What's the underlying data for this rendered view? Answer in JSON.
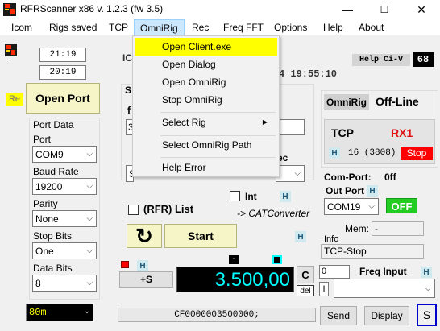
{
  "window": {
    "title": "RFRScanner  x86 v. 1.2.3  (fw 3.5)",
    "minimize": "—",
    "maximize": "☐",
    "close": "✕"
  },
  "menu": {
    "items": [
      "Icom",
      "Rigs saved",
      "TCP",
      "OmniRig",
      "Rec",
      "Freq FFT",
      "Options",
      "Help",
      "About"
    ]
  },
  "omnirig_menu": {
    "items": [
      "Open Client.exe",
      "Open Dialog",
      "Open OmniRig",
      "Stop OmniRig",
      "Select Rig",
      "Select OmniRig Path",
      "Help Error"
    ],
    "submenu_arrow": "▶"
  },
  "left": {
    "time_top": "21:19",
    "time_bottom": "20:19",
    "re_label": "Re",
    "open_port": "Open Port",
    "port_data_title": "Port Data",
    "port_label": "Port",
    "port_value": "COM9",
    "baud_label": "Baud Rate",
    "baud_value": "19200",
    "parity_label": "Parity",
    "parity_value": "None",
    "stop_bits_label": "Stop Bits",
    "stop_bits_value": "One",
    "data_bits_label": "Data Bits",
    "data_bits_value": "8",
    "band_value": "80m"
  },
  "center": {
    "ic_fragment": "IC",
    "datetime_fragment": "4 19:55:10",
    "s_fragment": "S",
    "f_fragment": "f",
    "three_fragment": "3",
    "s2_fragment": "S",
    "ec_fragment": "ec",
    "int_label": "Int",
    "h": "H",
    "rfr_list": "(RFR) List",
    "cat_converter": "-> CATConverter",
    "refresh_icon": "↻",
    "start": "Start",
    "plus_s": "+S",
    "frequency": "3.500,00",
    "c_button": "C",
    "del_button": "del",
    "minus_sign": "-",
    "command": "CF0000003500000;"
  },
  "right": {
    "help_civ": "Help Ci-V",
    "civ_address": "68",
    "omnirig_label": "OmniRig",
    "offline": "Off-Line",
    "tcp": "TCP",
    "rx1": "RX1",
    "h": "H",
    "port_count": "16 (3808)",
    "stop": "Stop",
    "com_port_label": "Com-Port:",
    "com_port_value": "0ff",
    "out_port_label": "Out Port",
    "out_port_value": "COM19",
    "off_button": "OFF",
    "mem_label": "Mem:",
    "mem_value": "-",
    "info_label": "Info",
    "info_value": "TCP-Stop",
    "freq_input_value": "0",
    "freq_input_label": "Freq Input",
    "i_label": "I",
    "send": "Send",
    "display": "Display",
    "s_button": "S"
  },
  "colors": {
    "yellow_highlight": "#ffff00",
    "frequency_text": "#00ffff",
    "stop_bg": "#ff0000",
    "off_bg": "#22cc22",
    "rx1_text": "#e01010",
    "band_text": "#ffff00"
  }
}
